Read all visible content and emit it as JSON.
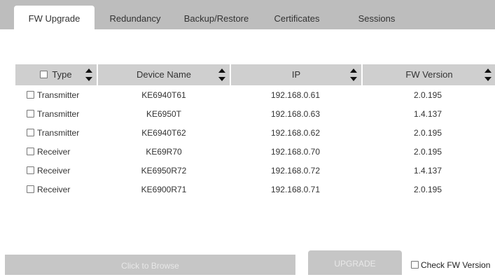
{
  "tabs": [
    {
      "label": "FW Upgrade",
      "active": true
    },
    {
      "label": "Redundancy",
      "active": false
    },
    {
      "label": "Backup/Restore",
      "active": false
    },
    {
      "label": "Certificates",
      "active": false
    },
    {
      "label": "Sessions",
      "active": false
    }
  ],
  "table": {
    "columns": [
      "Type",
      "Device Name",
      "IP",
      "FW Version"
    ],
    "rows": [
      {
        "type": "Transmitter",
        "name": "KE6940T61",
        "ip": "192.168.0.61",
        "fw": "2.0.195"
      },
      {
        "type": "Transmitter",
        "name": "KE6950T",
        "ip": "192.168.0.63",
        "fw": "1.4.137"
      },
      {
        "type": "Transmitter",
        "name": "KE6940T62",
        "ip": "192.168.0.62",
        "fw": "2.0.195"
      },
      {
        "type": "Receiver",
        "name": "KE69R70",
        "ip": "192.168.0.70",
        "fw": "2.0.195"
      },
      {
        "type": "Receiver",
        "name": "KE6950R72",
        "ip": "192.168.0.72",
        "fw": "1.4.137"
      },
      {
        "type": "Receiver",
        "name": "KE6900R71",
        "ip": "192.168.0.71",
        "fw": "2.0.195"
      }
    ]
  },
  "controls": {
    "browse_label": "Click to Browse",
    "upgrade_label": "UPGRADE",
    "check_fw_label": "Check FW Version"
  },
  "colors": {
    "tabbar_bg": "#bdbdbd",
    "header_bg": "#cfcfcf",
    "disabled_button_bg": "#c6c6c6"
  }
}
